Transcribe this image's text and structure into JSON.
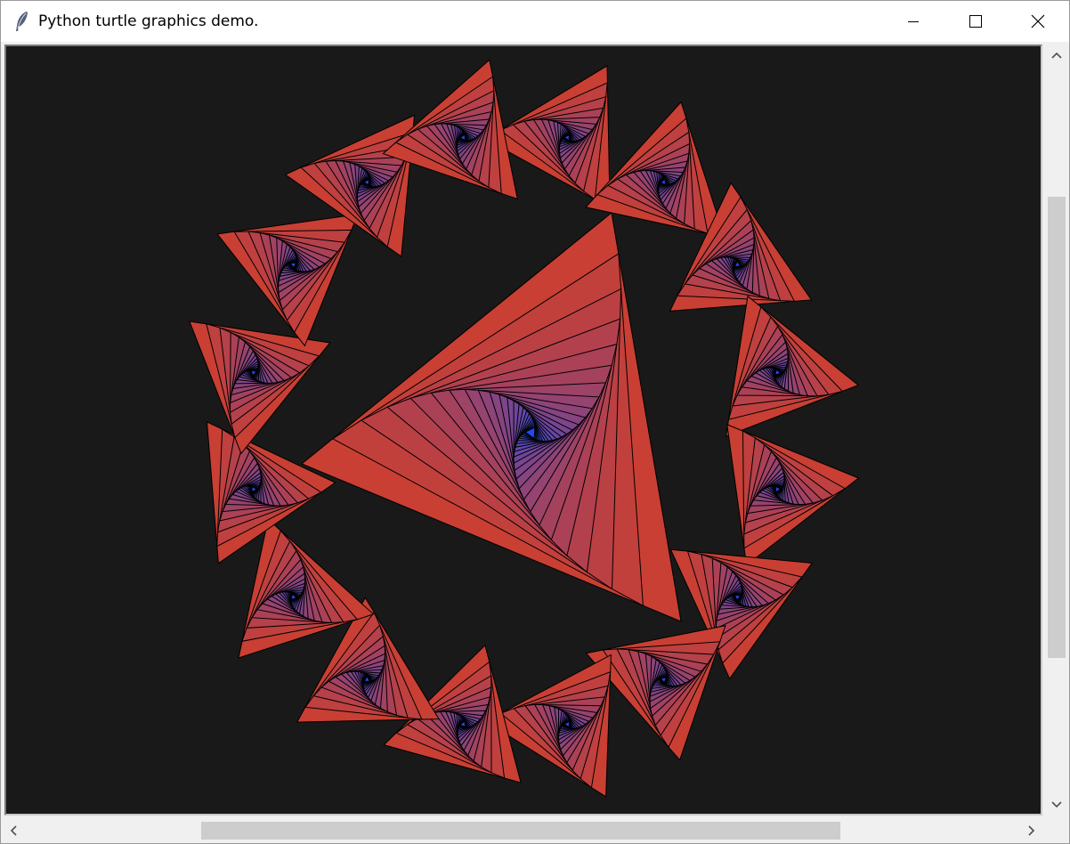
{
  "window": {
    "title": "Python turtle graphics demo.",
    "icon": "feather-icon",
    "controls": {
      "minimize": "minimize-icon",
      "maximize": "maximize-icon",
      "close": "close-icon"
    }
  },
  "canvas": {
    "background": "#191919",
    "outline_color": "#000000",
    "color_outer": "#c93f33",
    "color_inner": "#1d4dfa"
  },
  "scrollbars": {
    "vertical": {
      "up_icon": "chevron-up-icon",
      "down_icon": "chevron-down-icon"
    },
    "horizontal": {
      "left_icon": "chevron-left-icon",
      "right_icon": "chevron-right-icon"
    }
  }
}
